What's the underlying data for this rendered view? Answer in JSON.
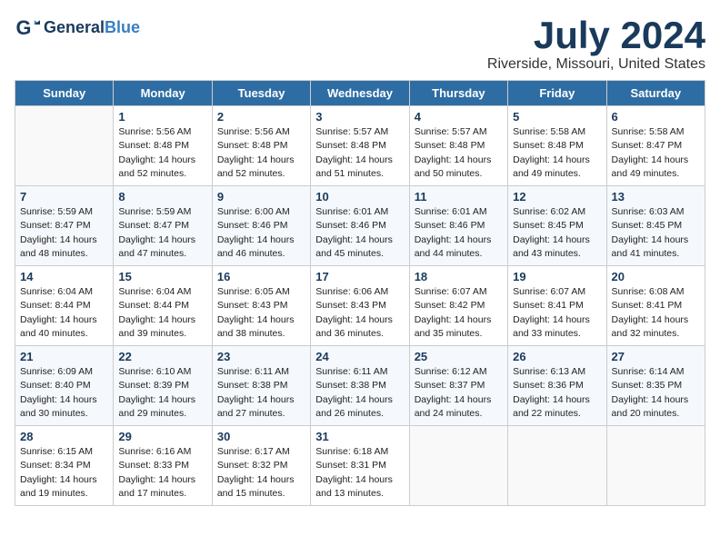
{
  "logo": {
    "general": "General",
    "blue": "Blue"
  },
  "title": {
    "month": "July 2024",
    "location": "Riverside, Missouri, United States"
  },
  "weekdays": [
    "Sunday",
    "Monday",
    "Tuesday",
    "Wednesday",
    "Thursday",
    "Friday",
    "Saturday"
  ],
  "weeks": [
    [
      {
        "day": "",
        "sunrise": "",
        "sunset": "",
        "daylight": ""
      },
      {
        "day": "1",
        "sunrise": "Sunrise: 5:56 AM",
        "sunset": "Sunset: 8:48 PM",
        "daylight": "Daylight: 14 hours and 52 minutes."
      },
      {
        "day": "2",
        "sunrise": "Sunrise: 5:56 AM",
        "sunset": "Sunset: 8:48 PM",
        "daylight": "Daylight: 14 hours and 52 minutes."
      },
      {
        "day": "3",
        "sunrise": "Sunrise: 5:57 AM",
        "sunset": "Sunset: 8:48 PM",
        "daylight": "Daylight: 14 hours and 51 minutes."
      },
      {
        "day": "4",
        "sunrise": "Sunrise: 5:57 AM",
        "sunset": "Sunset: 8:48 PM",
        "daylight": "Daylight: 14 hours and 50 minutes."
      },
      {
        "day": "5",
        "sunrise": "Sunrise: 5:58 AM",
        "sunset": "Sunset: 8:48 PM",
        "daylight": "Daylight: 14 hours and 49 minutes."
      },
      {
        "day": "6",
        "sunrise": "Sunrise: 5:58 AM",
        "sunset": "Sunset: 8:47 PM",
        "daylight": "Daylight: 14 hours and 49 minutes."
      }
    ],
    [
      {
        "day": "7",
        "sunrise": "Sunrise: 5:59 AM",
        "sunset": "Sunset: 8:47 PM",
        "daylight": "Daylight: 14 hours and 48 minutes."
      },
      {
        "day": "8",
        "sunrise": "Sunrise: 5:59 AM",
        "sunset": "Sunset: 8:47 PM",
        "daylight": "Daylight: 14 hours and 47 minutes."
      },
      {
        "day": "9",
        "sunrise": "Sunrise: 6:00 AM",
        "sunset": "Sunset: 8:46 PM",
        "daylight": "Daylight: 14 hours and 46 minutes."
      },
      {
        "day": "10",
        "sunrise": "Sunrise: 6:01 AM",
        "sunset": "Sunset: 8:46 PM",
        "daylight": "Daylight: 14 hours and 45 minutes."
      },
      {
        "day": "11",
        "sunrise": "Sunrise: 6:01 AM",
        "sunset": "Sunset: 8:46 PM",
        "daylight": "Daylight: 14 hours and 44 minutes."
      },
      {
        "day": "12",
        "sunrise": "Sunrise: 6:02 AM",
        "sunset": "Sunset: 8:45 PM",
        "daylight": "Daylight: 14 hours and 43 minutes."
      },
      {
        "day": "13",
        "sunrise": "Sunrise: 6:03 AM",
        "sunset": "Sunset: 8:45 PM",
        "daylight": "Daylight: 14 hours and 41 minutes."
      }
    ],
    [
      {
        "day": "14",
        "sunrise": "Sunrise: 6:04 AM",
        "sunset": "Sunset: 8:44 PM",
        "daylight": "Daylight: 14 hours and 40 minutes."
      },
      {
        "day": "15",
        "sunrise": "Sunrise: 6:04 AM",
        "sunset": "Sunset: 8:44 PM",
        "daylight": "Daylight: 14 hours and 39 minutes."
      },
      {
        "day": "16",
        "sunrise": "Sunrise: 6:05 AM",
        "sunset": "Sunset: 8:43 PM",
        "daylight": "Daylight: 14 hours and 38 minutes."
      },
      {
        "day": "17",
        "sunrise": "Sunrise: 6:06 AM",
        "sunset": "Sunset: 8:43 PM",
        "daylight": "Daylight: 14 hours and 36 minutes."
      },
      {
        "day": "18",
        "sunrise": "Sunrise: 6:07 AM",
        "sunset": "Sunset: 8:42 PM",
        "daylight": "Daylight: 14 hours and 35 minutes."
      },
      {
        "day": "19",
        "sunrise": "Sunrise: 6:07 AM",
        "sunset": "Sunset: 8:41 PM",
        "daylight": "Daylight: 14 hours and 33 minutes."
      },
      {
        "day": "20",
        "sunrise": "Sunrise: 6:08 AM",
        "sunset": "Sunset: 8:41 PM",
        "daylight": "Daylight: 14 hours and 32 minutes."
      }
    ],
    [
      {
        "day": "21",
        "sunrise": "Sunrise: 6:09 AM",
        "sunset": "Sunset: 8:40 PM",
        "daylight": "Daylight: 14 hours and 30 minutes."
      },
      {
        "day": "22",
        "sunrise": "Sunrise: 6:10 AM",
        "sunset": "Sunset: 8:39 PM",
        "daylight": "Daylight: 14 hours and 29 minutes."
      },
      {
        "day": "23",
        "sunrise": "Sunrise: 6:11 AM",
        "sunset": "Sunset: 8:38 PM",
        "daylight": "Daylight: 14 hours and 27 minutes."
      },
      {
        "day": "24",
        "sunrise": "Sunrise: 6:11 AM",
        "sunset": "Sunset: 8:38 PM",
        "daylight": "Daylight: 14 hours and 26 minutes."
      },
      {
        "day": "25",
        "sunrise": "Sunrise: 6:12 AM",
        "sunset": "Sunset: 8:37 PM",
        "daylight": "Daylight: 14 hours and 24 minutes."
      },
      {
        "day": "26",
        "sunrise": "Sunrise: 6:13 AM",
        "sunset": "Sunset: 8:36 PM",
        "daylight": "Daylight: 14 hours and 22 minutes."
      },
      {
        "day": "27",
        "sunrise": "Sunrise: 6:14 AM",
        "sunset": "Sunset: 8:35 PM",
        "daylight": "Daylight: 14 hours and 20 minutes."
      }
    ],
    [
      {
        "day": "28",
        "sunrise": "Sunrise: 6:15 AM",
        "sunset": "Sunset: 8:34 PM",
        "daylight": "Daylight: 14 hours and 19 minutes."
      },
      {
        "day": "29",
        "sunrise": "Sunrise: 6:16 AM",
        "sunset": "Sunset: 8:33 PM",
        "daylight": "Daylight: 14 hours and 17 minutes."
      },
      {
        "day": "30",
        "sunrise": "Sunrise: 6:17 AM",
        "sunset": "Sunset: 8:32 PM",
        "daylight": "Daylight: 14 hours and 15 minutes."
      },
      {
        "day": "31",
        "sunrise": "Sunrise: 6:18 AM",
        "sunset": "Sunset: 8:31 PM",
        "daylight": "Daylight: 14 hours and 13 minutes."
      },
      {
        "day": "",
        "sunrise": "",
        "sunset": "",
        "daylight": ""
      },
      {
        "day": "",
        "sunrise": "",
        "sunset": "",
        "daylight": ""
      },
      {
        "day": "",
        "sunrise": "",
        "sunset": "",
        "daylight": ""
      }
    ]
  ]
}
